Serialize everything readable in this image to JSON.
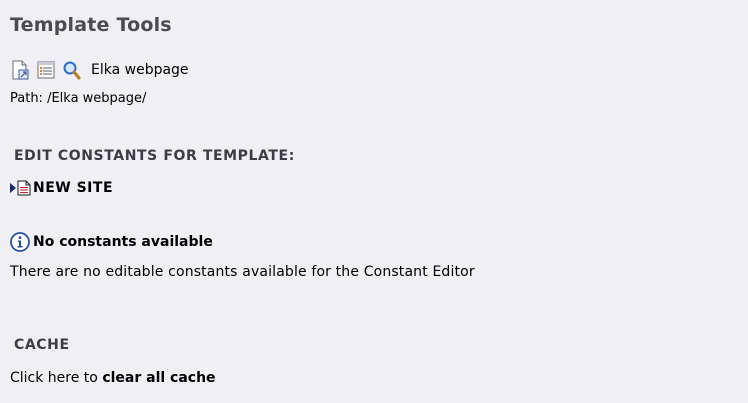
{
  "title": "Template Tools",
  "toolbar": {
    "icons": [
      "edit-template-icon",
      "list-icon",
      "magnifier-icon"
    ],
    "page_name": "Elka webpage"
  },
  "path": "Path: /Elka webpage/",
  "edit_constants": {
    "heading": "EDIT CONSTANTS FOR TEMPLATE:",
    "site_label": "NEW SITE"
  },
  "info": {
    "title": "No constants available",
    "message": "There are no editable constants available for the Constant Editor"
  },
  "cache": {
    "heading": "CACHE",
    "prefix": "Click here to ",
    "link": "clear all cache"
  },
  "colors": {
    "background": "#efeff4",
    "heading": "#4a4a55",
    "info_icon": "#2a4fa8"
  }
}
